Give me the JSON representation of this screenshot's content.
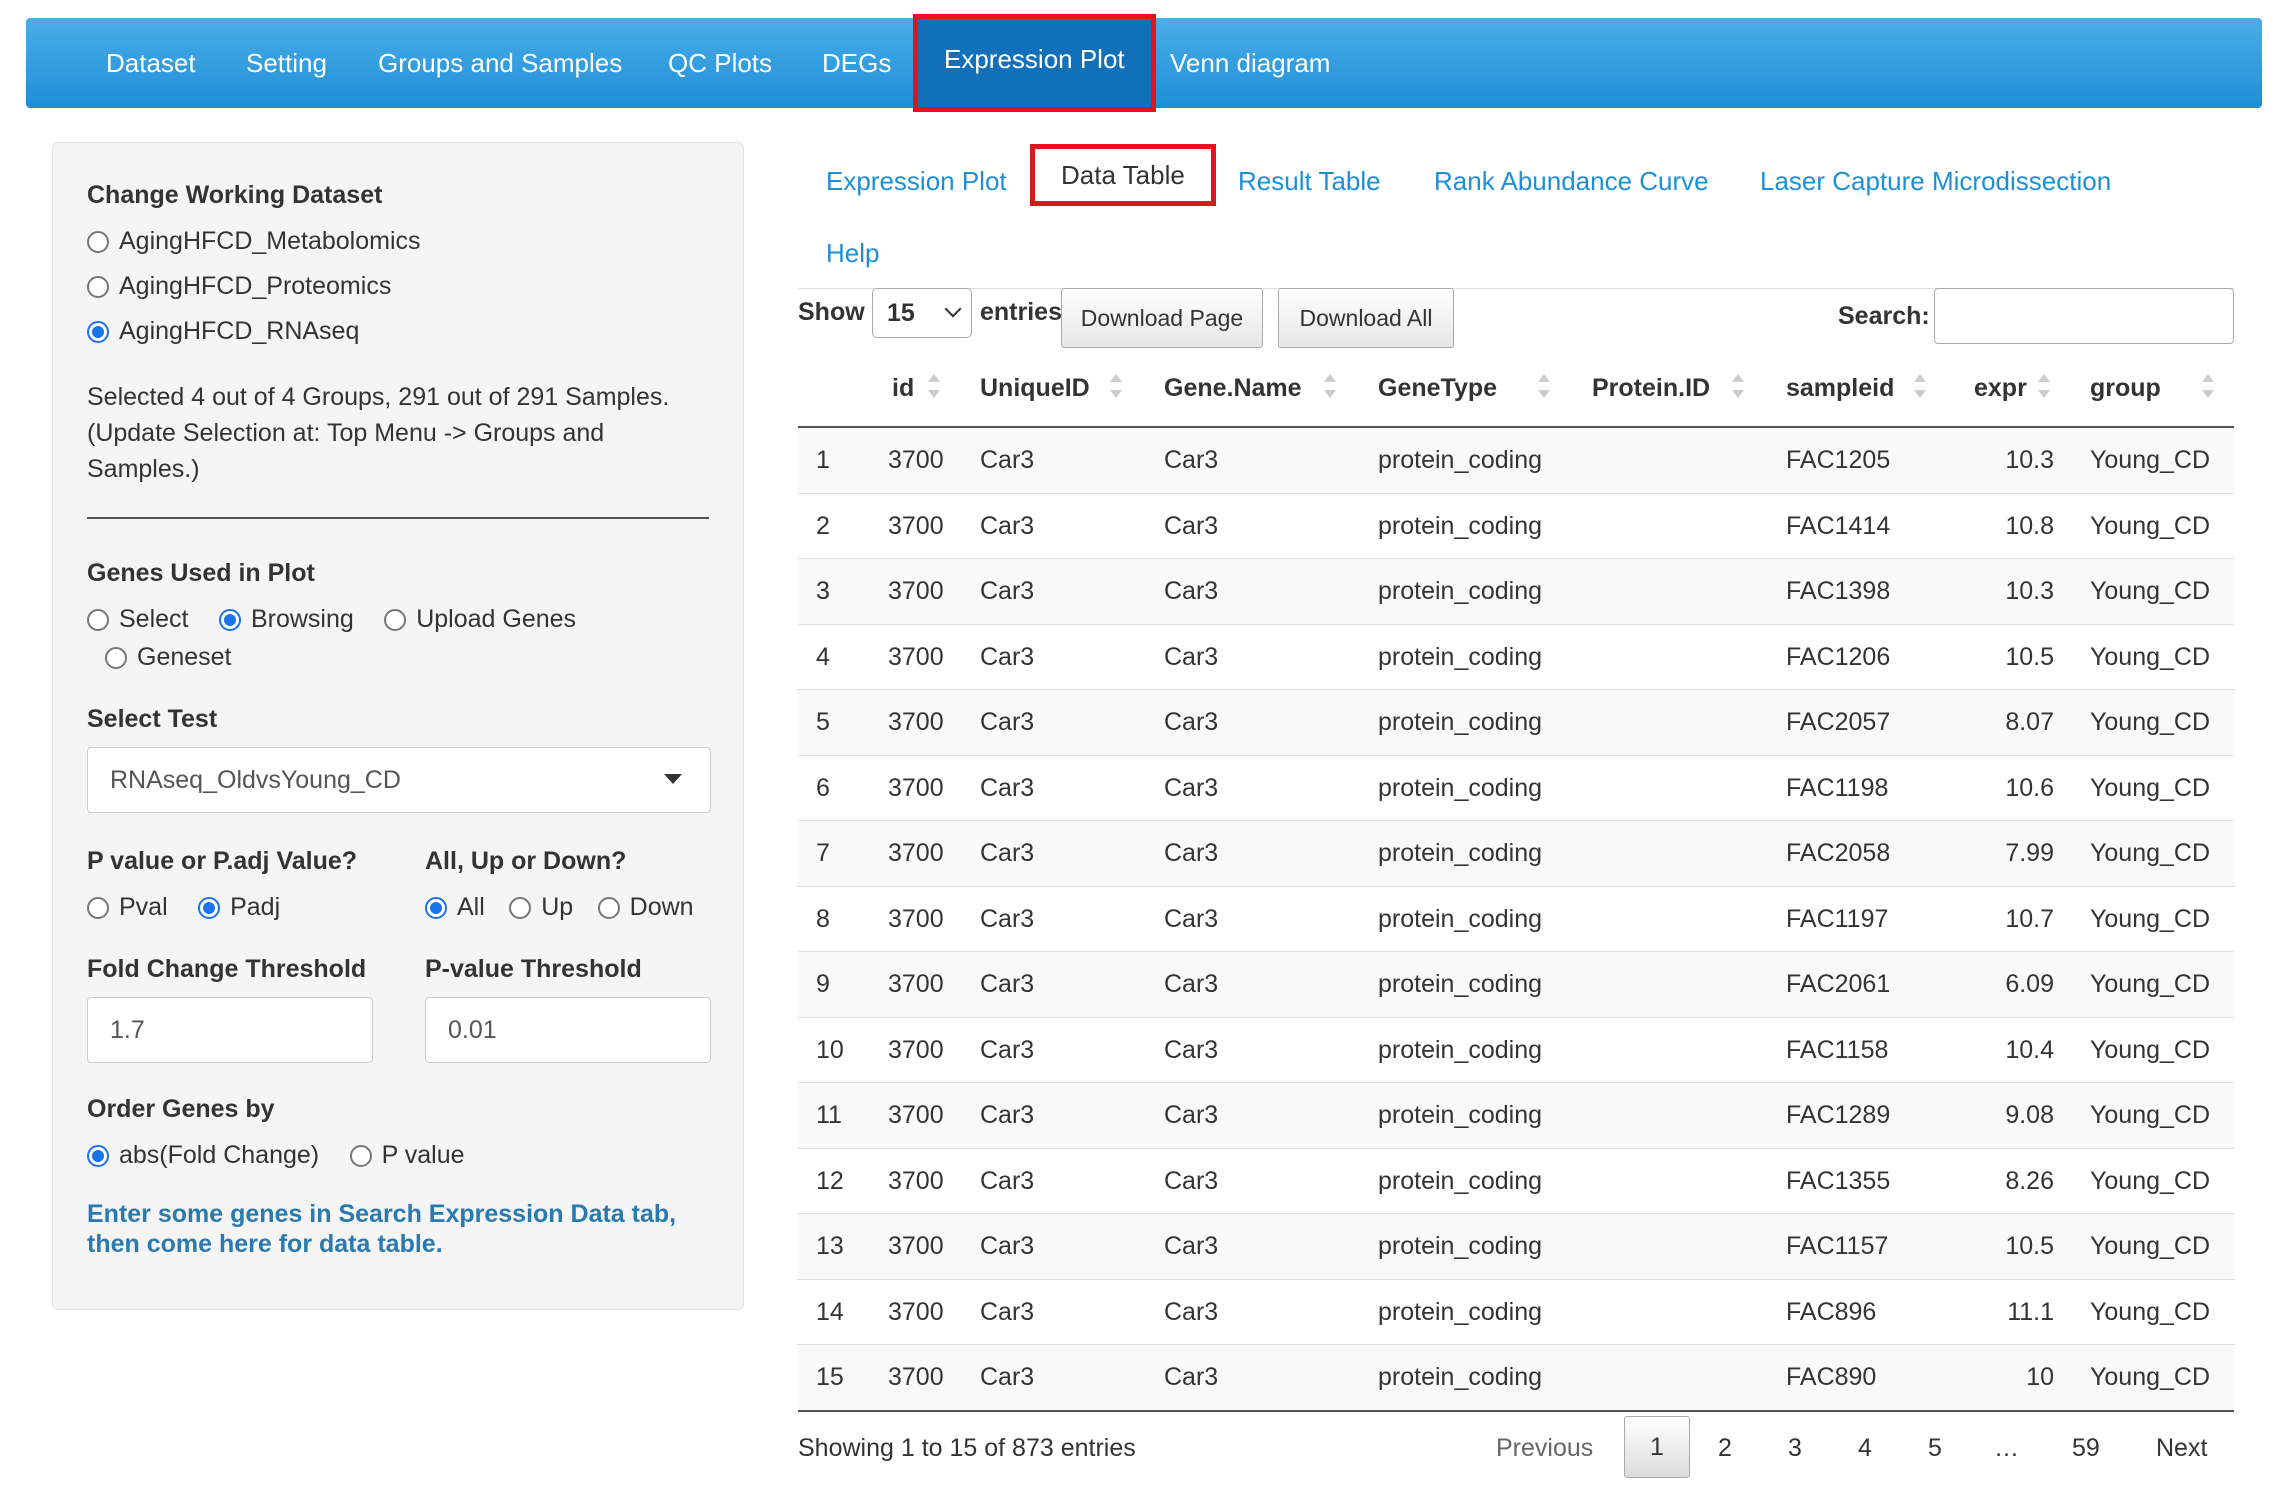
{
  "nav": {
    "items": [
      "Dataset",
      "Setting",
      "Groups and Samples",
      "QC Plots",
      "DEGs",
      "Expression Plot",
      "Venn diagram"
    ],
    "active": "Expression Plot"
  },
  "sidebar": {
    "dataset_label": "Change Working Dataset",
    "datasets": [
      "AgingHFCD_Metabolomics",
      "AgingHFCD_Proteomics",
      "AgingHFCD_RNAseq"
    ],
    "selection_info": [
      "Selected 4 out of 4 Groups, 291 out of 291 Samples.",
      "(Update Selection at: Top Menu -> Groups and",
      "Samples.)"
    ],
    "genes_label": "Genes Used in Plot",
    "genes_options": [
      "Select",
      "Browsing",
      "Upload Genes",
      "Geneset"
    ],
    "test_label": "Select Test",
    "test_value": "RNAseq_OldvsYoung_CD",
    "pval_label": "P value or P.adj Value?",
    "pval_options": [
      "Pval",
      "Padj"
    ],
    "dir_label": "All, Up or Down?",
    "dir_options": [
      "All",
      "Up",
      "Down"
    ],
    "fc_label": "Fold Change Threshold",
    "fc_value": "1.7",
    "pthr_label": "P-value Threshold",
    "pthr_value": "0.01",
    "order_label": "Order Genes by",
    "order_options": [
      "abs(Fold Change)",
      "P value"
    ],
    "note": "Enter some genes in Search Expression Data tab, then come here for data table."
  },
  "tabs": [
    "Expression Plot",
    "Data Table",
    "Result Table",
    "Rank Abundance Curve",
    "Laser Capture Microdissection",
    "Help"
  ],
  "controls": {
    "show": "Show",
    "entries_value": "15",
    "entries": "entries",
    "download_page": "Download Page",
    "download_all": "Download All",
    "search": "Search:"
  },
  "table": {
    "columns": [
      "id",
      "UniqueID",
      "Gene.Name",
      "GeneType",
      "Protein.ID",
      "sampleid",
      "expr",
      "group"
    ],
    "rows": [
      [
        "1",
        "3700",
        "Car3",
        "Car3",
        "protein_coding",
        "",
        "FAC1205",
        "10.3",
        "Young_CD"
      ],
      [
        "2",
        "3700",
        "Car3",
        "Car3",
        "protein_coding",
        "",
        "FAC1414",
        "10.8",
        "Young_CD"
      ],
      [
        "3",
        "3700",
        "Car3",
        "Car3",
        "protein_coding",
        "",
        "FAC1398",
        "10.3",
        "Young_CD"
      ],
      [
        "4",
        "3700",
        "Car3",
        "Car3",
        "protein_coding",
        "",
        "FAC1206",
        "10.5",
        "Young_CD"
      ],
      [
        "5",
        "3700",
        "Car3",
        "Car3",
        "protein_coding",
        "",
        "FAC2057",
        "8.07",
        "Young_CD"
      ],
      [
        "6",
        "3700",
        "Car3",
        "Car3",
        "protein_coding",
        "",
        "FAC1198",
        "10.6",
        "Young_CD"
      ],
      [
        "7",
        "3700",
        "Car3",
        "Car3",
        "protein_coding",
        "",
        "FAC2058",
        "7.99",
        "Young_CD"
      ],
      [
        "8",
        "3700",
        "Car3",
        "Car3",
        "protein_coding",
        "",
        "FAC1197",
        "10.7",
        "Young_CD"
      ],
      [
        "9",
        "3700",
        "Car3",
        "Car3",
        "protein_coding",
        "",
        "FAC2061",
        "6.09",
        "Young_CD"
      ],
      [
        "10",
        "3700",
        "Car3",
        "Car3",
        "protein_coding",
        "",
        "FAC1158",
        "10.4",
        "Young_CD"
      ],
      [
        "11",
        "3700",
        "Car3",
        "Car3",
        "protein_coding",
        "",
        "FAC1289",
        "9.08",
        "Young_CD"
      ],
      [
        "12",
        "3700",
        "Car3",
        "Car3",
        "protein_coding",
        "",
        "FAC1355",
        "8.26",
        "Young_CD"
      ],
      [
        "13",
        "3700",
        "Car3",
        "Car3",
        "protein_coding",
        "",
        "FAC1157",
        "10.5",
        "Young_CD"
      ],
      [
        "14",
        "3700",
        "Car3",
        "Car3",
        "protein_coding",
        "",
        "FAC896",
        "11.1",
        "Young_CD"
      ],
      [
        "15",
        "3700",
        "Car3",
        "Car3",
        "protein_coding",
        "",
        "FAC890",
        "10",
        "Young_CD"
      ]
    ]
  },
  "footer": {
    "showing": "Showing 1 to 15 of 873 entries",
    "previous": "Previous",
    "pages": [
      "1",
      "2",
      "3",
      "4",
      "5",
      "…",
      "59"
    ],
    "next": "Next"
  }
}
